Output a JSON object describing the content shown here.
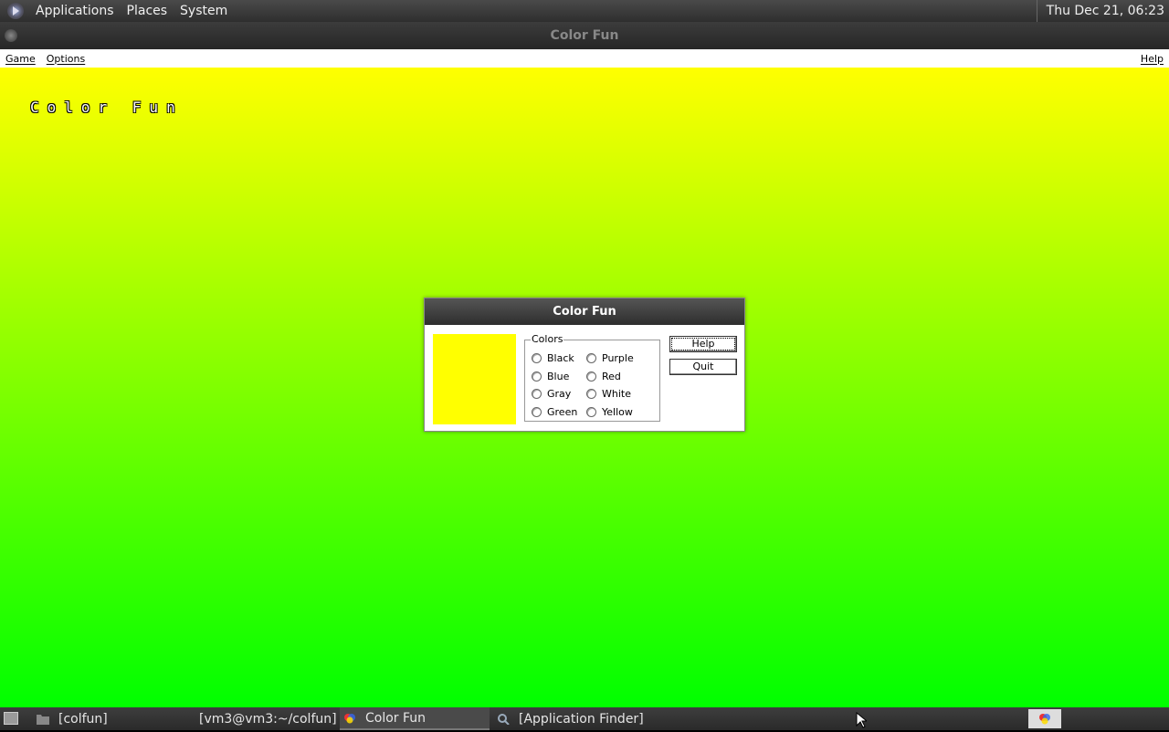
{
  "top_panel": {
    "menus": [
      "Applications",
      "Places",
      "System"
    ],
    "clock": "Thu Dec 21, 06:23"
  },
  "window": {
    "title": "Color Fun",
    "menubar": {
      "game": "Game",
      "options": "Options",
      "help": "Help"
    },
    "canvas_title": "Color Fun",
    "gradient": {
      "top": "#ffff00",
      "bottom": "#00ff00"
    }
  },
  "dialog": {
    "title": "Color Fun",
    "swatch_color": "#ffff00",
    "group_label": "Colors",
    "colors": [
      "Black",
      "Blue",
      "Gray",
      "Green",
      "Purple",
      "Red",
      "White",
      "Yellow"
    ],
    "help_label": "Help",
    "quit_label": "Quit"
  },
  "taskbar": {
    "tasks": [
      "[colfun]",
      "[vm3@vm3:~/colfun]",
      "Color Fun",
      "[Application Finder]"
    ],
    "active_task": "Color Fun"
  }
}
